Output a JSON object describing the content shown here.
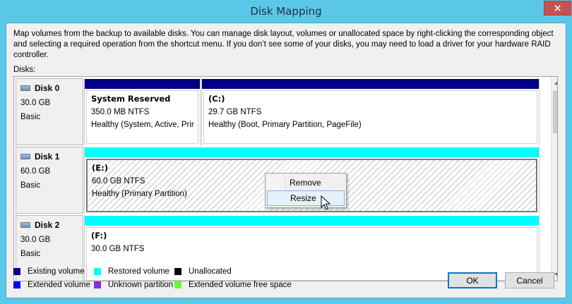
{
  "window": {
    "title": "Disk Mapping",
    "close_glyph": "✕"
  },
  "description": "Map volumes from the backup to available disks. You can manage disk layout, volumes or unallocated space by right-clicking the corresponding object and selecting a required operation from the shortcut menu. If you don’t see some of your disks, you may need to load a driver for your hardware RAID controller.",
  "disks_label": "Disks:",
  "disks": [
    {
      "name": "Disk 0",
      "size": "30.0 GB",
      "type": "Basic",
      "partitions": [
        {
          "title": "System Reserved",
          "fs": "350.0 MB NTFS",
          "status": "Healthy (System, Active, Prir",
          "bar_color": "#000080"
        },
        {
          "title": "(C:)",
          "fs": "29.7 GB NTFS",
          "status": "Healthy (Boot, Primary Partition, PageFile)",
          "bar_color": "#000080"
        }
      ]
    },
    {
      "name": "Disk 1",
      "size": "60.0 GB",
      "type": "Basic",
      "partitions": [
        {
          "title": "(E:)",
          "fs": "60.0 GB NTFS",
          "status": "Healthy (Primary Partition)",
          "bar_color": "#00ffff"
        }
      ]
    },
    {
      "name": "Disk 2",
      "size": "30.0 GB",
      "type": "Basic",
      "partitions": [
        {
          "title": "(F:)",
          "fs": "30.0 GB NTFS",
          "status": "",
          "bar_color": "#00ffff"
        }
      ]
    }
  ],
  "context_menu": {
    "items": [
      "Remove",
      "Resize"
    ],
    "highlighted": "Resize"
  },
  "legend": [
    {
      "label": "Existing volume",
      "color": "#000080"
    },
    {
      "label": "Restored volume",
      "color": "#00ffff"
    },
    {
      "label": "Unallocated",
      "color": "#000000"
    },
    {
      "label": "Extended volume",
      "color": "#0000ff"
    },
    {
      "label": "Unknown partition",
      "color": "#8a2be2"
    },
    {
      "label": "Extended volume free space",
      "color": "#66ff33"
    }
  ],
  "buttons": {
    "ok": "OK",
    "cancel": "Cancel"
  },
  "icons": {
    "close": "close-icon",
    "scroll_up": "scroll-up-icon",
    "scroll_down": "scroll-down-icon",
    "disk": "disk-icon",
    "cursor": "mouse-pointer-icon"
  }
}
